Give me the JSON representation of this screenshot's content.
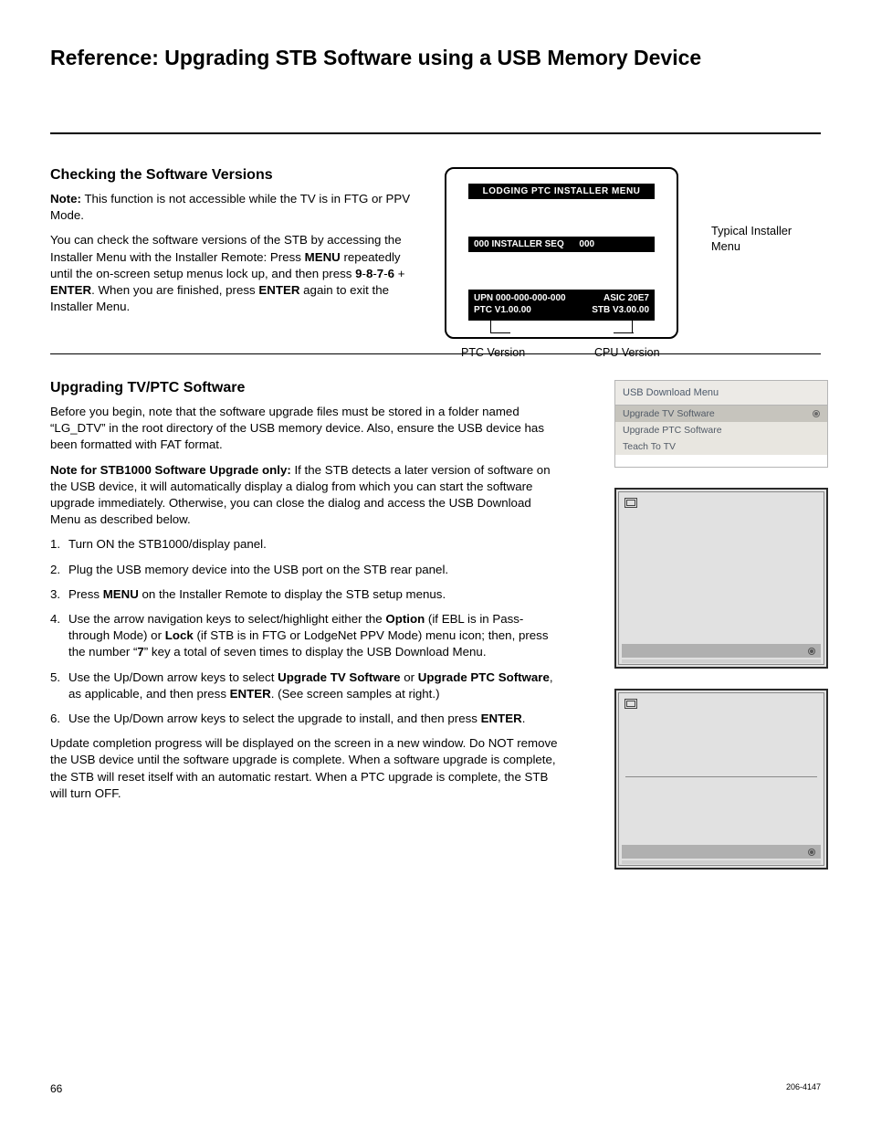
{
  "doc": {
    "title": "Reference: Upgrading STB Software using a USB Memory Device",
    "page_number": "66",
    "doc_number": "206-4147"
  },
  "sec1": {
    "heading": "Checking the Software Versions",
    "note_label": "Note:",
    "note_text": " This function is not accessible while the TV is in FTG or PPV Mode.",
    "p1a": "You can check the software versions of the STB by accessing the Installer Menu with the Installer Remote: Press ",
    "p1_menu": "MENU",
    "p1b": " repeatedly until the on-screen setup menus lock up, and then press ",
    "p1_keys": "9",
    "p1_dash1": "-",
    "p1_k8": "8",
    "p1_dash2": "-",
    "p1_k7": "7",
    "p1_dash3": "-",
    "p1_k6": "6",
    "p1_plus": " + ",
    "p1_enter": "ENTER",
    "p1c": ". When you are finished, press ",
    "p1_enter2": "ENTER",
    "p1d": " again to exit the Installer Menu."
  },
  "installer": {
    "title": "LODGING  PTC  INSTALLER  MENU",
    "mid_left": "000   INSTALLER SEQ",
    "mid_right": "000",
    "upn_label": "UPN  000-000-000-000",
    "asic": "ASIC  20E7",
    "ptc": "PTC  V1.00.00",
    "stb": "STB  V3.00.00",
    "ptc_label": "PTC Version",
    "cpu_label": "CPU Version",
    "typical": "Typical Installer Menu"
  },
  "sec2": {
    "heading": "Upgrading TV/PTC Software",
    "p1": "Before you begin, note that the software upgrade files must be stored in a folder named “LG_DTV” in the root directory of the USB memory device. Also, ensure the USB device has been formatted with FAT format.",
    "p2_label": "Note for STB1000 Software Upgrade only:",
    "p2_text": " If the STB detects a later version of software on the USB device, it will automatically display a dialog from which you can start the software upgrade immediately. Otherwise, you can close the dialog and access the USB Download Menu as described below.",
    "ol": {
      "i1": "Turn ON the STB1000/display panel.",
      "i2": "Plug the USB memory device into the USB port on the STB rear panel.",
      "i3a": "Press ",
      "i3_menu": "MENU",
      "i3b": " on the Installer Remote to display the STB setup menus.",
      "i4a": "Use the arrow navigation keys to select/highlight either the ",
      "i4_option": "Option",
      "i4b": " (if EBL is in Pass-through Mode) or ",
      "i4_lock": "Lock",
      "i4c": " (if STB is in FTG or LodgeNet PPV Mode) menu icon; then, press the number “",
      "i4_seven": "7",
      "i4d": "” key a total of seven times to display the USB Download Menu.",
      "i5a": "Use the Up/Down arrow keys to select ",
      "i5_utv": "Upgrade TV Software",
      "i5b": " or ",
      "i5_uptc": "Upgrade PTC Software",
      "i5c": ", as applicable, and then press ",
      "i5_enter": "ENTER",
      "i5d": ". (See screen samples at right.)",
      "i6a": "Use the Up/Down arrow keys to select the upgrade to install, and then press ",
      "i6_enter": "ENTER",
      "i6b": "."
    },
    "p3": "Update completion progress will be displayed on the screen in a new window. Do NOT remove the USB device until the software upgrade is complete. When a software upgrade is complete, the STB will reset itself with an automatic restart. When a PTC upgrade is complete, the STB will turn OFF."
  },
  "usb_menu": {
    "title": "USB Download Menu",
    "items": [
      "Upgrade TV Software",
      "Upgrade PTC Software",
      "Teach To TV"
    ],
    "selected_index": 0
  }
}
